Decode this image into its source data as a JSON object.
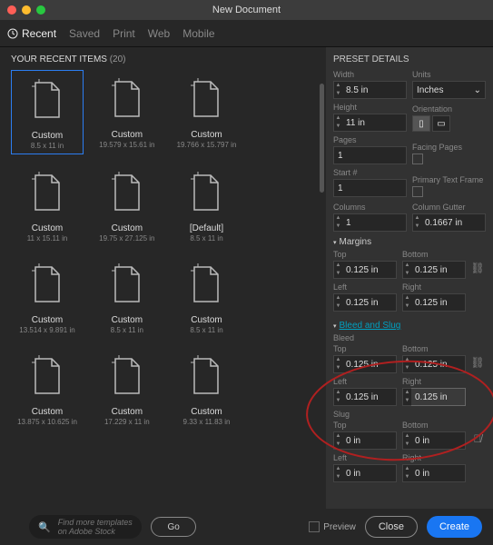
{
  "window": {
    "title": "New Document"
  },
  "doc_tabs": [
    "Recent",
    "Saved",
    "Print",
    "Web",
    "Mobile"
  ],
  "recent": {
    "header": "YOUR RECENT ITEMS",
    "count": "(20)"
  },
  "items": [
    {
      "title": "Custom",
      "dim": "8.5 x 11 in",
      "sel": true
    },
    {
      "title": "Custom",
      "dim": "19.579 x 15.61 in"
    },
    {
      "title": "Custom",
      "dim": "19.766 x 15.797 in"
    },
    {
      "title": "",
      "dim": ""
    },
    {
      "title": "Custom",
      "dim": "11 x 15.11 in"
    },
    {
      "title": "Custom",
      "dim": "19.75 x 27.125 in"
    },
    {
      "title": "[Default]",
      "dim": "8.5 x 11 in"
    },
    {
      "title": "",
      "dim": ""
    },
    {
      "title": "Custom",
      "dim": "13.514 x 9.891 in"
    },
    {
      "title": "Custom",
      "dim": "8.5 x 11 in"
    },
    {
      "title": "Custom",
      "dim": "8.5 x 11 in"
    },
    {
      "title": "",
      "dim": ""
    },
    {
      "title": "Custom",
      "dim": "13.875 x 10.625 in"
    },
    {
      "title": "Custom",
      "dim": "17.229 x 11 in"
    },
    {
      "title": "Custom",
      "dim": "9.33 x 11.83 in"
    },
    {
      "title": "",
      "dim": ""
    }
  ],
  "preset": {
    "title": "PRESET DETAILS",
    "width_label": "Width",
    "width": "8.5 in",
    "units_label": "Units",
    "units": "Inches",
    "height_label": "Height",
    "height": "11 in",
    "orientation_label": "Orientation",
    "pages_label": "Pages",
    "pages": "1",
    "facing_label": "Facing Pages",
    "start_label": "Start #",
    "start": "1",
    "ptf_label": "Primary Text Frame",
    "columns_label": "Columns",
    "columns": "1",
    "gutter_label": "Column Gutter",
    "gutter": "0.1667 in",
    "margins_label": "Margins",
    "top_label": "Top",
    "bottom_label": "Bottom",
    "left_label": "Left",
    "right_label": "Right",
    "m_top": "0.125 in",
    "m_bottom": "0.125 in",
    "m_left": "0.125 in",
    "m_right": "0.125 in",
    "bleed_slug_label": "Bleed and Slug",
    "bleed_label": "Bleed",
    "b_top": "0.125 in",
    "b_bottom": "0.125 in",
    "b_left": "0.125 in",
    "b_right": "0.125 in",
    "slug_label": "Slug",
    "s_top": "0 in",
    "s_bottom": "0 in",
    "s_left": "0 in",
    "s_right": "0 in"
  },
  "footer": {
    "search_placeholder": "Find more templates on Adobe Stock",
    "go": "Go",
    "preview": "Preview",
    "close": "Close",
    "create": "Create"
  }
}
